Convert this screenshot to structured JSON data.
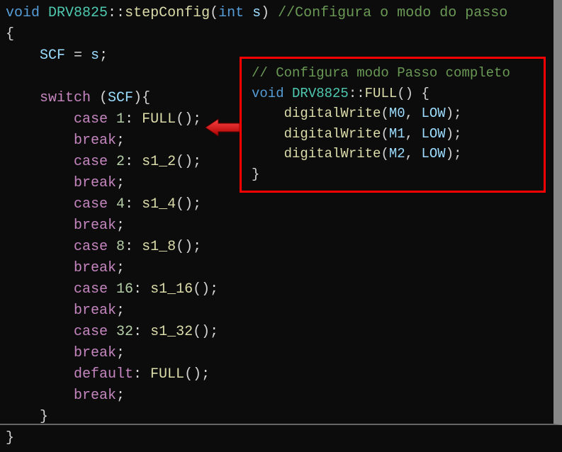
{
  "main": {
    "l1_void": "void",
    "l1_class": "DRV8825",
    "l1_scope": "::",
    "l1_func": "stepConfig",
    "l1_parenO": "(",
    "l1_int": "int",
    "l1_param": " s",
    "l1_parenC": ")",
    "l1_comment": " //Configura o modo do passo",
    "l2_brace": "{",
    "l3_pad": "    ",
    "l3_var": "SCF",
    "l3_eq": " = ",
    "l3_val": "s",
    "l3_semi": ";",
    "l5_pad": "    ",
    "l5_switch": "switch",
    "l5_open": " (",
    "l5_expr": "SCF",
    "l5_close": "){",
    "c1_pad": "        ",
    "c1_case": "case",
    "c1_sp": " ",
    "c1_num": "1",
    "c1_colon": ": ",
    "c1_func": "FULL",
    "c1_call": "();",
    "b_pad": "        ",
    "b_break": "break",
    "b_semi": ";",
    "c2_num": "2",
    "c2_func": "s1_2",
    "c4_num": "4",
    "c4_func": "s1_4",
    "c8_num": "8",
    "c8_func": "s1_8",
    "c16_num": "16",
    "c16_func": "s1_16",
    "c32_num": "32",
    "c32_func": "s1_32",
    "def_pad": "        ",
    "def_kw": "default",
    "def_colon": ": ",
    "def_func": "FULL",
    "def_call": "();",
    "end_pad": "    ",
    "end_brace": "}",
    "last_brace": "}"
  },
  "callout": {
    "l1_comment": "// Configura modo Passo completo",
    "l2_void": "void",
    "l2_class": " DRV8825",
    "l2_scope": "::",
    "l2_func": "FULL",
    "l2_tail": "() {",
    "l3_pad": "    ",
    "l3_func": "digitalWrite",
    "l3_open": "(",
    "l3_arg1": "M0",
    "l3_comma": ", ",
    "l3_arg2": "LOW",
    "l3_close": ");",
    "l4_arg1": "M1",
    "l5_arg1": "M2",
    "l6_brace": "}"
  }
}
